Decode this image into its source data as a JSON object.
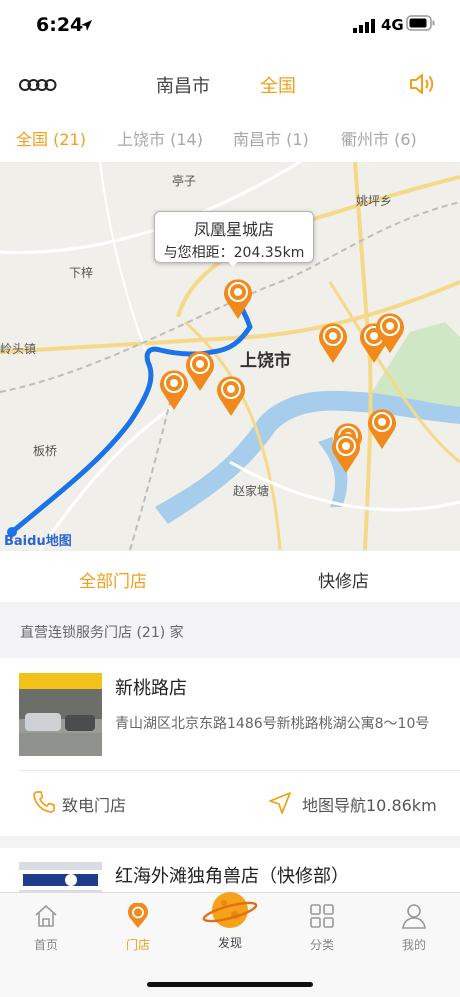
{
  "status_bar": {
    "time": "6:24",
    "network": "4G"
  },
  "header": {
    "city_label": "南昌市",
    "nation_label": "全国"
  },
  "region_tabs": [
    {
      "label": "全国 (21)",
      "active": true
    },
    {
      "label": "上饶市 (14)",
      "active": false
    },
    {
      "label": "南昌市 (1)",
      "active": false
    },
    {
      "label": "衢州市 (6)",
      "active": false
    }
  ],
  "map": {
    "place_labels": [
      "亭子",
      "姚坪乡",
      "下梓",
      "岭头镇",
      "上饶市",
      "板桥",
      "赵家塘"
    ],
    "tooltip": {
      "title": "凤凰星城店",
      "distance": "与您相距：204.35km"
    },
    "logo_text": "Baidu地图"
  },
  "store_tabs": {
    "all": "全部门店",
    "quick": "快修店"
  },
  "section_title": "直营连锁服务门店 (21) 家",
  "stores": [
    {
      "name": "新桃路店",
      "address": "青山湖区北京东路1486号新桃路桃湖公寓8～10号",
      "call": "致电门店",
      "nav": "地图导航10.86km"
    },
    {
      "name": "红海外滩独角兽店（快修部）"
    }
  ],
  "tabbar": {
    "home": "首页",
    "stores": "门店",
    "discover": "发现",
    "category": "分类",
    "mine": "我的"
  },
  "colors": {
    "accent": "#f0a019",
    "route": "#1a73e8",
    "pin": "#f08a1c"
  }
}
